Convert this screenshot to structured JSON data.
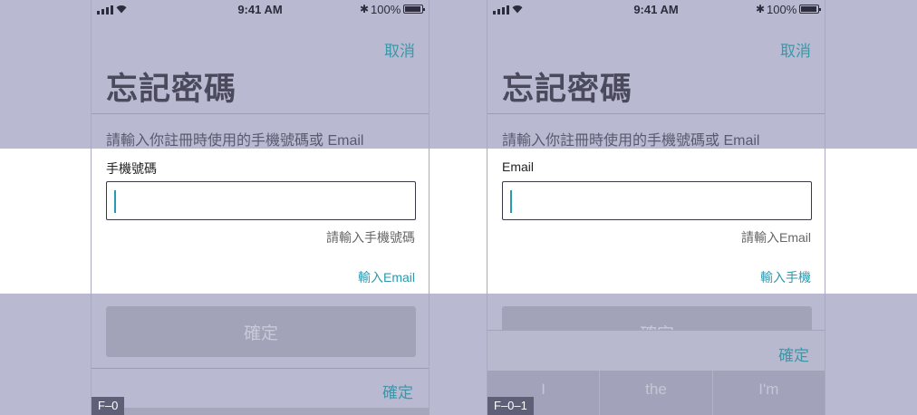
{
  "screens": [
    {
      "status": {
        "time": "9:41 AM",
        "battery": "100%",
        "bluetooth_symbol": "✱"
      },
      "cancel": "取消",
      "title": "忘記密碼",
      "instruction": "請輸入你註冊時使用的手機號碼或 Email",
      "field_label": "手機號碼",
      "input_value": "",
      "hint": "請輸入手機號碼",
      "switch_link": "輸入Email",
      "confirm_button": "確定",
      "bottom_confirm": "確定",
      "tag": "F–0"
    },
    {
      "status": {
        "time": "9:41 AM",
        "battery": "100%",
        "bluetooth_symbol": "✱"
      },
      "cancel": "取消",
      "title": "忘記密碼",
      "instruction": "請輸入你註冊時使用的手機號碼或 Email",
      "field_label": "Email",
      "input_value": "",
      "hint": "請輸入Email",
      "switch_link": "輸入手機",
      "confirm_button": "確定",
      "accessory_confirm": "確定",
      "suggestions": [
        "I",
        "the",
        "I'm"
      ],
      "tag": "F–0–1"
    }
  ],
  "colors": {
    "accent": "#3a98a8",
    "overlay": "#b9b9d2",
    "tag_bg": "#5f5f78"
  },
  "icons": [
    "signal-icon",
    "wifi-icon",
    "bluetooth-icon",
    "battery-icon"
  ]
}
